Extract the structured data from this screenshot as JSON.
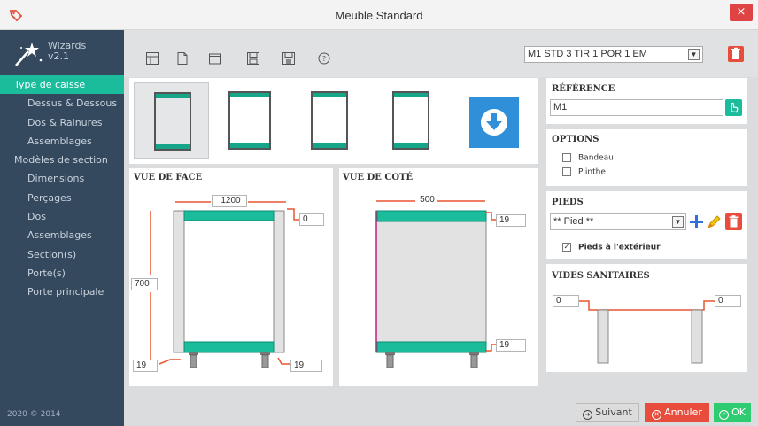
{
  "window": {
    "title": "Meuble Standard",
    "close_glyph": "×"
  },
  "sidebar": {
    "brand_name": "Wizards",
    "brand_version": "v2.1",
    "items": [
      {
        "label": "Type de caisse",
        "active": true
      },
      {
        "label": "Dessus & Dessous"
      },
      {
        "label": "Dos & Rainures"
      },
      {
        "label": "Assemblages"
      },
      {
        "label": "Modèles de section",
        "section": true
      },
      {
        "label": "Dimensions"
      },
      {
        "label": "Perçages"
      },
      {
        "label": "Dos"
      },
      {
        "label": "Assemblages"
      },
      {
        "label": "Section(s)"
      },
      {
        "label": "Porte(s)"
      },
      {
        "label": "Porte principale"
      }
    ],
    "footer": "2020 © 2014"
  },
  "toolbar": {
    "icons": [
      "layout-icon",
      "new-file-icon",
      "open-folder-icon",
      "save-icon",
      "save-as-icon",
      "help-icon"
    ],
    "model_value": "M1 STD 3 TIR 1 POR 1 EM"
  },
  "front_view": {
    "title": "VUE DE FACE",
    "width": "1200",
    "height": "700",
    "top_offset": "0",
    "bottom_left": "19",
    "bottom_right": "19"
  },
  "side_view": {
    "title": "VUE DE COTÉ",
    "depth": "500",
    "top_thickness": "19",
    "bottom_thickness": "19"
  },
  "reference": {
    "title": "RÉFÉRENCE",
    "value": "M1"
  },
  "options": {
    "title": "OPTIONS",
    "items": [
      {
        "label": "Bandeau",
        "checked": false
      },
      {
        "label": "Plinthe",
        "checked": false
      }
    ]
  },
  "pieds": {
    "title": "PIEDS",
    "select_value": "** Pied **",
    "exterior_label": "Pieds à l'extérieur",
    "exterior_checked": true
  },
  "vides": {
    "title": "VIDES SANITAIRES",
    "left": "0",
    "right": "0"
  },
  "buttons": {
    "next": "Suivant",
    "cancel": "Annuler",
    "ok": "OK"
  },
  "colors": {
    "accent": "#1abc9c",
    "sidebar": "#34495e",
    "danger": "#e74c3c",
    "primary": "#2f8fd9",
    "ok": "#2ecc71",
    "dimension": "#e8552f"
  }
}
